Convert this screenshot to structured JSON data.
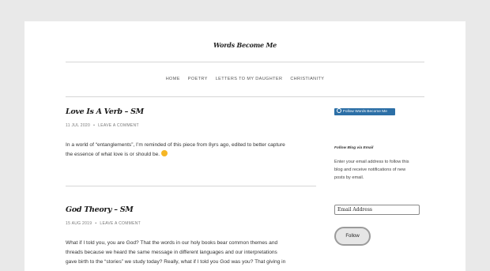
{
  "site": {
    "title": "Words Become Me"
  },
  "nav": {
    "items": [
      "HOME",
      "POETRY",
      "LETTERS TO MY DAUGHTER",
      "CHRISTIANITY"
    ]
  },
  "posts": [
    {
      "title": "Love Is A Verb – SM",
      "date": "11 JUL 2020",
      "comment_link": "LEAVE A COMMENT",
      "body": [
        "In a world of “entanglements”, I’m reminded of this piece from 8yrs ago, edited to better capture",
        "the essence of what love is or should be."
      ]
    },
    {
      "title": "God Theory – SM",
      "date": "15 AUG 2019",
      "comment_link": "LEAVE A COMMENT",
      "body": [
        "What if I told you, you are God? That the words in our holy books bear common themes and",
        "threads because we heard the same message in different languages and our interpretations",
        "gave birth to the “stories” we study today? Really, what if I told you God was you? That giving in"
      ]
    }
  ],
  "sidebar": {
    "follow_badge_label": "Follow Words Become Me",
    "widget_title": "Follow Blog via Email",
    "widget_text": [
      "Enter your email address to follow this",
      "blog and receive notifications of new",
      "posts by email."
    ],
    "email_placeholder": "Email Address",
    "follow_button_label": "Follow"
  }
}
